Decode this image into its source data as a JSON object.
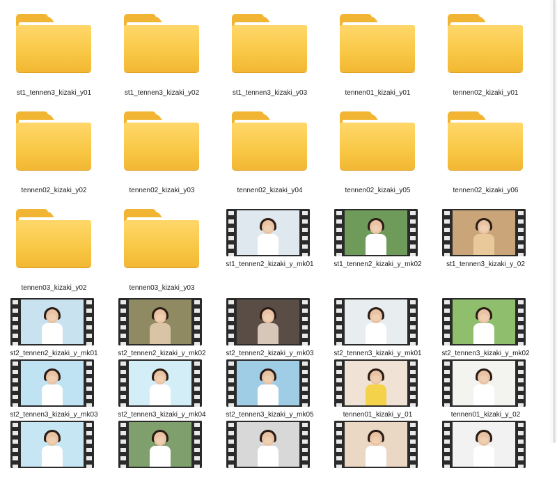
{
  "items": [
    {
      "label": "st1_tennen3_kizaki_y01",
      "type": "folder"
    },
    {
      "label": "st1_tennen3_kizaki_y02",
      "type": "folder"
    },
    {
      "label": "st1_tennen3_kizaki_y03",
      "type": "folder"
    },
    {
      "label": "tennen01_kizaki_y01",
      "type": "folder"
    },
    {
      "label": "tennen02_kizaki_y01",
      "type": "folder"
    },
    {
      "label": "tennen02_kizaki_y02",
      "type": "folder"
    },
    {
      "label": "tennen02_kizaki_y03",
      "type": "folder"
    },
    {
      "label": "tennen02_kizaki_y04",
      "type": "folder"
    },
    {
      "label": "tennen02_kizaki_y05",
      "type": "folder"
    },
    {
      "label": "tennen02_kizaki_y06",
      "type": "folder"
    },
    {
      "label": "tennen03_kizaki_y02",
      "type": "folder"
    },
    {
      "label": "tennen03_kizaki_y03",
      "type": "folder"
    },
    {
      "label": "st1_tennen2_kizaki_y_mk01",
      "type": "video",
      "bg": "#dfe8ef",
      "accent": "#ffffff"
    },
    {
      "label": "st1_tennen2_kizaki_y_mk02",
      "type": "video",
      "bg": "#6e9a5a",
      "accent": "#ffffff"
    },
    {
      "label": "st1_tennen3_kizaki_y_02",
      "type": "video",
      "bg": "#caa57a",
      "accent": "#e9c999"
    },
    {
      "label": "st2_tennen2_kizaki_y_mk01",
      "type": "video",
      "bg": "#c9e2ef",
      "accent": "#ffffff"
    },
    {
      "label": "st2_tennen2_kizaki_y_mk02",
      "type": "video",
      "bg": "#8f8a61",
      "accent": "#d9c5a6"
    },
    {
      "label": "st2_tennen2_kizaki_y_mk03",
      "type": "video",
      "bg": "#5a4d45",
      "accent": "#d7c7b9"
    },
    {
      "label": "st2_tennen3_kizaki_y_mk01",
      "type": "video",
      "bg": "#e8eef0",
      "accent": "#ffffff"
    },
    {
      "label": "st2_tennen3_kizaki_y_mk02",
      "type": "video",
      "bg": "#8fbf6c",
      "accent": "#ffffff"
    },
    {
      "label": "st2_tennen3_kizaki_y_mk03",
      "type": "video",
      "bg": "#bfe3f3",
      "accent": "#ffffff"
    },
    {
      "label": "st2_tennen3_kizaki_y_mk04",
      "type": "video",
      "bg": "#d4eef7",
      "accent": "#ffffff"
    },
    {
      "label": "st2_tennen3_kizaki_y_mk05",
      "type": "video",
      "bg": "#9fcde6",
      "accent": "#ffffff"
    },
    {
      "label": "tennen01_kizaki_y_01",
      "type": "video",
      "bg": "#f0e3d6",
      "accent": "#f4d24a"
    },
    {
      "label": "tennen01_kizaki_y_02",
      "type": "video",
      "bg": "#f3f3ef",
      "accent": "#ffffff"
    },
    {
      "label": "",
      "type": "video",
      "bg": "#c7e6f3",
      "accent": "#ffffff"
    },
    {
      "label": "",
      "type": "video",
      "bg": "#7fa06d",
      "accent": "#ffffff"
    },
    {
      "label": "",
      "type": "video",
      "bg": "#d8d8d8",
      "accent": "#ffffff"
    },
    {
      "label": "",
      "type": "video",
      "bg": "#ead7c4",
      "accent": "#ffffff"
    },
    {
      "label": "",
      "type": "video",
      "bg": "#f2f2f2",
      "accent": "#ffffff"
    }
  ]
}
